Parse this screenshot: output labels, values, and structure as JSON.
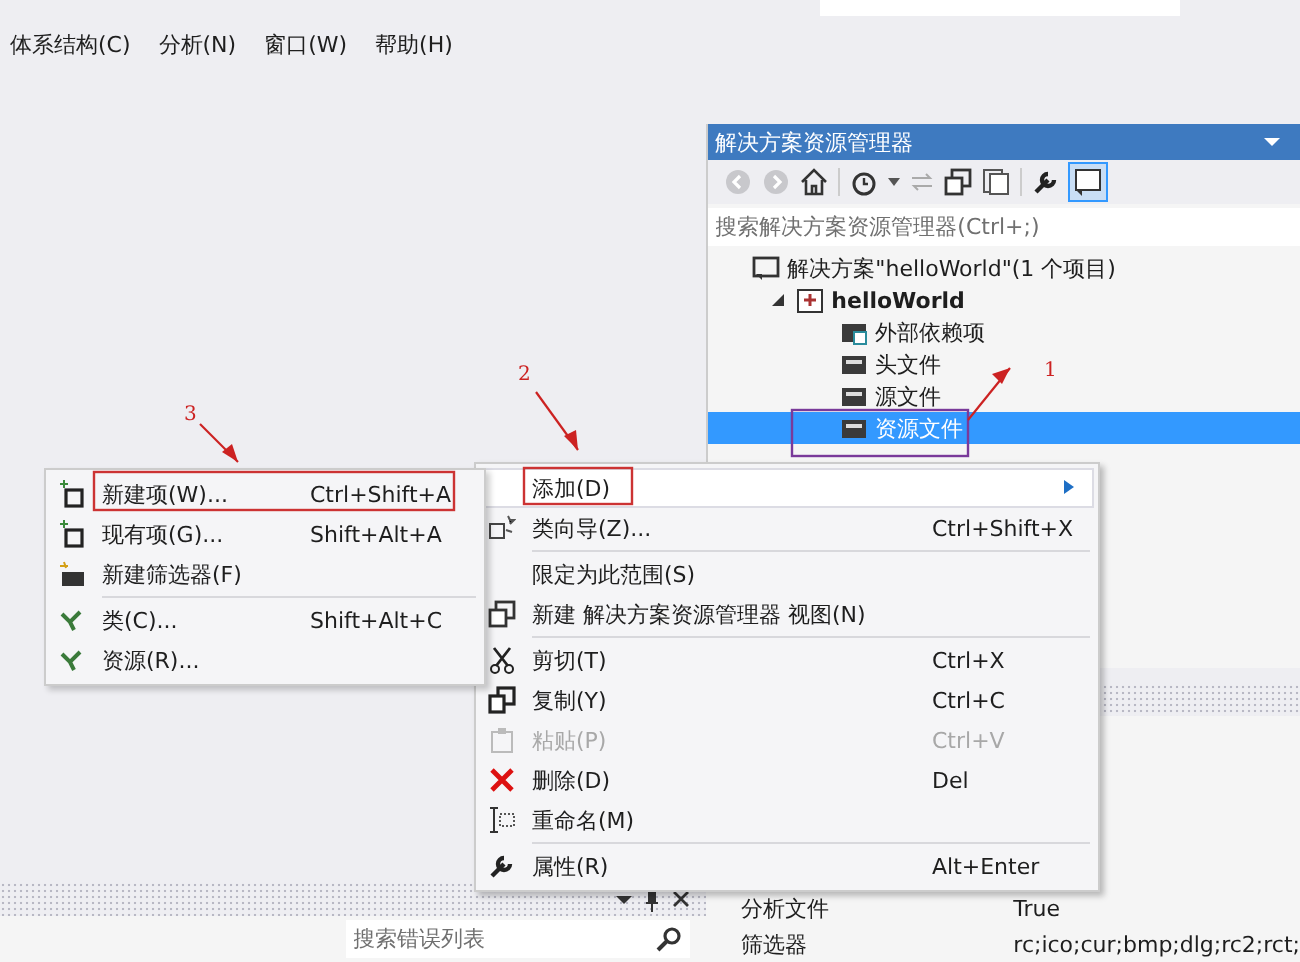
{
  "menu_bar": [
    {
      "label": "体系结构(C)"
    },
    {
      "label": "分析(N)"
    },
    {
      "label": "窗口(W)"
    },
    {
      "label": "帮助(H)"
    }
  ],
  "solution_explorer": {
    "title": "解决方案资源管理器",
    "search": {
      "placeholder": "搜索解决方案资源管理器(Ctrl+;)"
    },
    "tree": [
      {
        "label": "解决方案\"helloWorld\"(1 个项目)",
        "kind": "solution",
        "selected": false,
        "children": [
          {
            "label": "helloWorld",
            "kind": "project",
            "selected": false,
            "expanded": true,
            "children": [
              {
                "label": "外部依赖项",
                "kind": "deps",
                "selected": false
              },
              {
                "label": "头文件",
                "kind": "folder",
                "selected": false
              },
              {
                "label": "源文件",
                "kind": "folder",
                "selected": false
              },
              {
                "label": "资源文件",
                "kind": "folder",
                "selected": true
              }
            ]
          }
        ]
      }
    ]
  },
  "properties": {
    "rows": [
      {
        "name": "分析文件",
        "value": "True"
      },
      {
        "name": "筛选器",
        "value": "rc;ico;cur;bmp;dlg;rc2;rct;"
      }
    ]
  },
  "error_list": {
    "search": {
      "placeholder": "搜索错误列表"
    }
  },
  "context_menu": [
    {
      "kind": "item",
      "label": "添加(D)",
      "submenu": true,
      "selected": true,
      "disabled": false
    },
    {
      "kind": "item",
      "label": "类向导(Z)...",
      "shortcut": "Ctrl+Shift+X",
      "submenu": false,
      "selected": false,
      "disabled": false
    },
    {
      "kind": "separator"
    },
    {
      "kind": "item",
      "label": "限定为此范围(S)",
      "submenu": false,
      "selected": false,
      "disabled": false
    },
    {
      "kind": "item",
      "label": "新建 解决方案资源管理器 视图(N)",
      "submenu": false,
      "selected": false,
      "disabled": false
    },
    {
      "kind": "separator"
    },
    {
      "kind": "item",
      "label": "剪切(T)",
      "shortcut": "Ctrl+X",
      "submenu": false,
      "selected": false,
      "disabled": false
    },
    {
      "kind": "item",
      "label": "复制(Y)",
      "shortcut": "Ctrl+C",
      "submenu": false,
      "selected": false,
      "disabled": false
    },
    {
      "kind": "item",
      "label": "粘贴(P)",
      "shortcut": "Ctrl+V",
      "submenu": false,
      "selected": false,
      "disabled": true
    },
    {
      "kind": "item",
      "label": "删除(D)",
      "shortcut": "Del",
      "submenu": false,
      "selected": false,
      "disabled": false
    },
    {
      "kind": "item",
      "label": "重命名(M)",
      "submenu": false,
      "selected": false,
      "disabled": false
    },
    {
      "kind": "separator"
    },
    {
      "kind": "item",
      "label": "属性(R)",
      "shortcut": "Alt+Enter",
      "submenu": false,
      "selected": false,
      "disabled": false
    }
  ],
  "submenu": [
    {
      "kind": "item",
      "label": "新建项(W)...",
      "shortcut": "Ctrl+Shift+A"
    },
    {
      "kind": "item",
      "label": "现有项(G)...",
      "shortcut": "Shift+Alt+A"
    },
    {
      "kind": "item",
      "label": "新建筛选器(F)"
    },
    {
      "kind": "separator"
    },
    {
      "kind": "item",
      "label": "类(C)...",
      "shortcut": "Shift+Alt+C"
    },
    {
      "kind": "item",
      "label": "资源(R)..."
    }
  ],
  "annotations": [
    {
      "label": "1"
    },
    {
      "label": "2"
    },
    {
      "label": "3"
    }
  ]
}
